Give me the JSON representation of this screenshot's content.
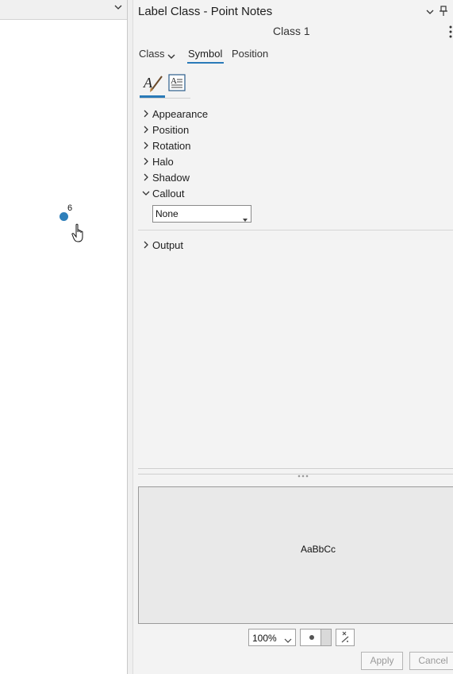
{
  "map": {
    "point_label": "6",
    "point_color": "#2e7fba",
    "icons": {
      "strip": "chevron-down-icon",
      "cursor": "hand-pointer-icon"
    }
  },
  "pane": {
    "title": "Label Class - Point Notes",
    "class_name": "Class 1",
    "icons": {
      "menu": "chevron-down-icon",
      "pin": "pin-icon",
      "more": "more-options-icon"
    },
    "tabs": {
      "class": "Class",
      "symbol": "Symbol",
      "position": "Position"
    },
    "subtabs": [
      "text-symbol-icon",
      "formatting-icon"
    ],
    "sections": [
      {
        "label": "Appearance",
        "expanded": false
      },
      {
        "label": "Position",
        "expanded": false
      },
      {
        "label": "Rotation",
        "expanded": false
      },
      {
        "label": "Halo",
        "expanded": false
      },
      {
        "label": "Shadow",
        "expanded": false
      },
      {
        "label": "Callout",
        "expanded": true
      },
      {
        "label": "Output",
        "expanded": false
      }
    ],
    "callout": {
      "value": "None"
    },
    "preview": {
      "sample_text": "AaBbCc"
    },
    "zoom": {
      "value": "100%"
    },
    "buttons": {
      "apply": "Apply",
      "cancel": "Cancel"
    },
    "accent_color": "#2a7ab8"
  }
}
